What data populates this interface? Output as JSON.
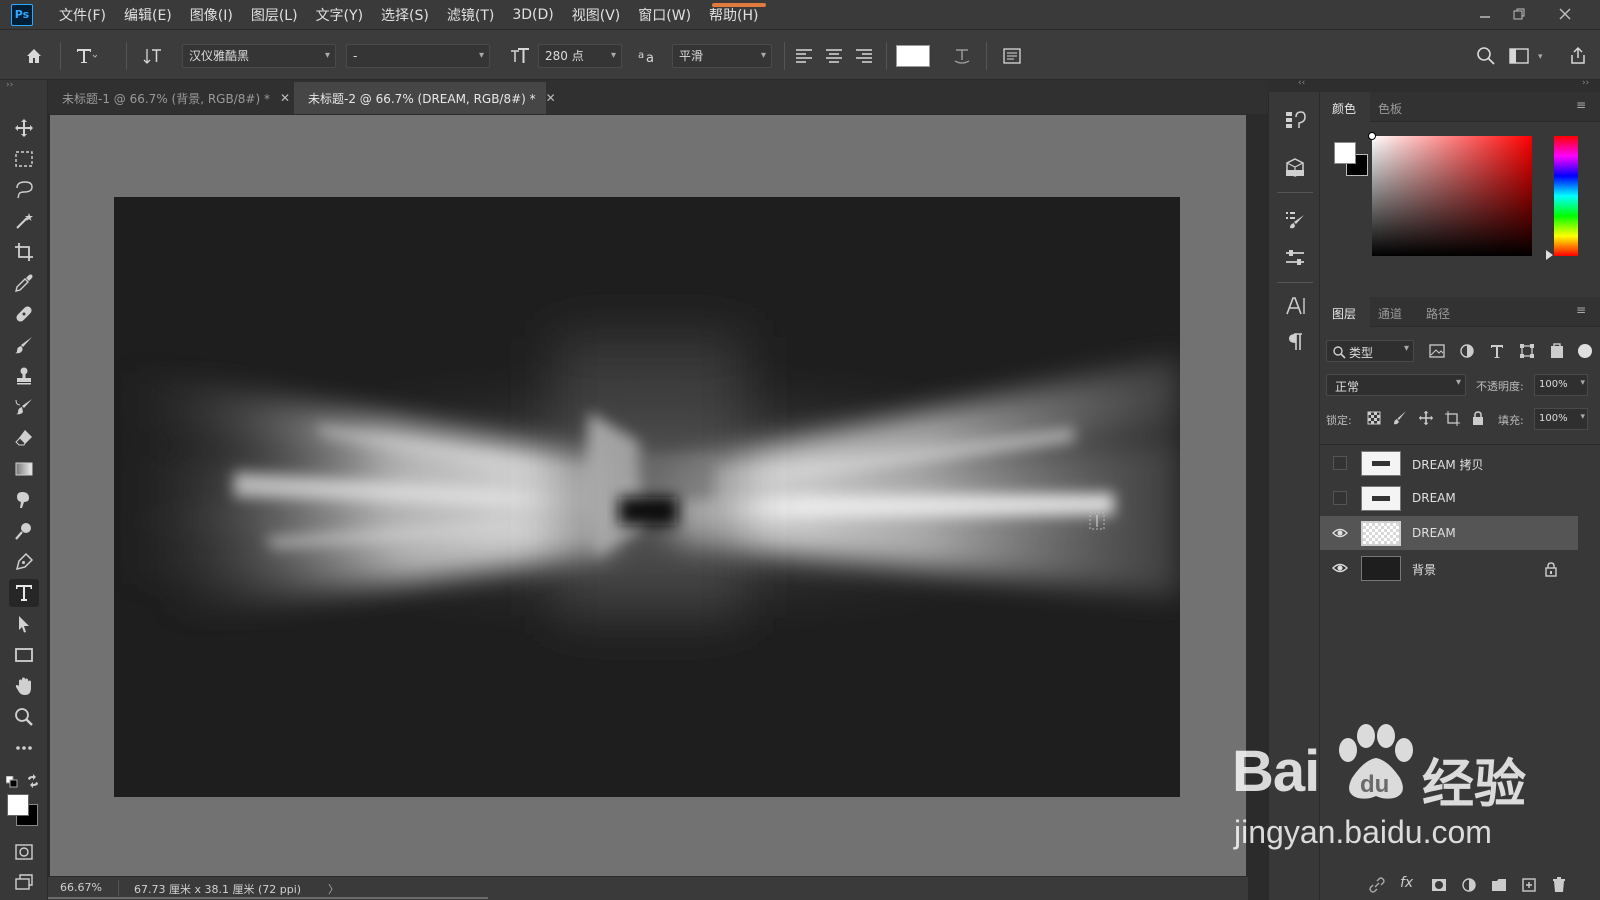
{
  "app": {
    "logo": "Ps"
  },
  "menu": [
    "文件(F)",
    "编辑(E)",
    "图像(I)",
    "图层(L)",
    "文字(Y)",
    "选择(S)",
    "滤镜(T)",
    "3D(D)",
    "视图(V)",
    "窗口(W)",
    "帮助(H)"
  ],
  "options": {
    "font_family": "汉仪雅酷黑",
    "font_style": "-",
    "font_size": "280 点",
    "antialias": "平滑"
  },
  "tabs": [
    {
      "label": "未标题-1 @ 66.7% (背景, RGB/8#) *",
      "active": false
    },
    {
      "label": "未标题-2 @ 66.7% (DREAM, RGB/8#) *",
      "active": true
    }
  ],
  "status": {
    "zoom": "66.67%",
    "doc_info": "67.73 厘米 x 38.1 厘米 (72 ppi)",
    "arrow": "〉"
  },
  "color_panel": {
    "tabs": [
      "颜色",
      "色板"
    ],
    "foreground": "#ffffff",
    "background": "#000000",
    "hue_color": "#ff0000"
  },
  "layers_panel": {
    "tabs": [
      "图层",
      "通道",
      "路径"
    ],
    "filter_label": "类型",
    "blend_mode": "正常",
    "opacity_label": "不透明度:",
    "opacity_value": "100%",
    "lock_label": "锁定:",
    "fill_label": "填充:",
    "fill_value": "100%",
    "layers": [
      {
        "name": "DREAM 拷贝",
        "visible": false,
        "selected": false,
        "locked": false
      },
      {
        "name": "DREAM",
        "visible": false,
        "selected": false,
        "locked": false
      },
      {
        "name": "DREAM",
        "visible": true,
        "selected": true,
        "locked": false
      },
      {
        "name": "背景",
        "visible": true,
        "selected": false,
        "locked": true
      }
    ]
  },
  "watermark": {
    "brand_left": "Bai",
    "brand_right": "经验",
    "url": "jingyan.baidu.com"
  }
}
